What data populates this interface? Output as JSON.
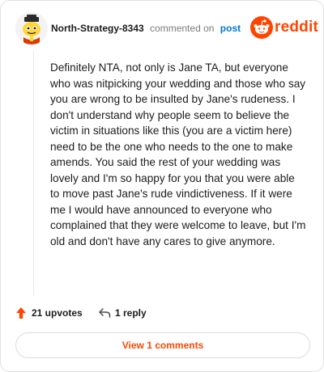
{
  "header": {
    "username": "North-Strategy-8343",
    "action_text": "commented on",
    "post_link": "post",
    "brand_wordmark": "reddit",
    "brand_color": "#ff4500",
    "link_color": "#0079d3",
    "avatar_icon": "snoo-avatar-icon"
  },
  "comment": {
    "body": "Definitely NTA, not only is Jane TA, but everyone who was nitpicking your wedding and those who say you are wrong to be insulted by Jane's rudeness. I don't understand why people seem to believe the victim in situations like this (you are a victim here) need to be the one who needs to the one to make amends. You said the rest of your wedding was lovely and I'm so happy for you that you were able to move past Jane's rude vindictiveness. If it were me I would have announced to everyone who complained that they were welcome to leave, but I'm old and don't have any cares to give anymore."
  },
  "actions": {
    "upvote_label": "21 upvotes",
    "upvote_icon": "upvote-arrow-icon",
    "reply_label": "1 reply",
    "reply_icon": "reply-arrow-icon"
  },
  "footer": {
    "view_comments_label": "View 1 comments"
  }
}
